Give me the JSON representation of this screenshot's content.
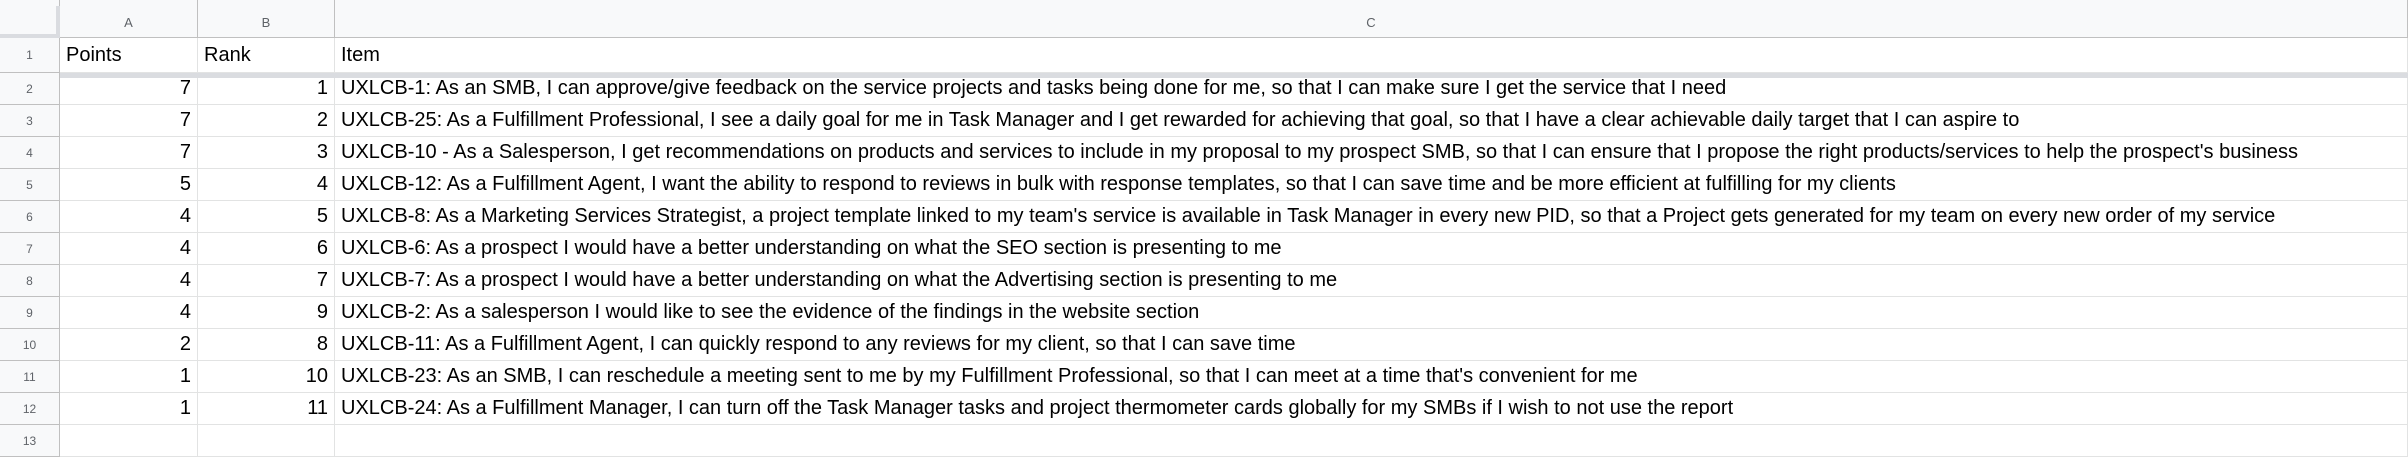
{
  "column_headers": [
    "A",
    "B",
    "C"
  ],
  "row_numbers": [
    "1",
    "2",
    "3",
    "4",
    "5",
    "6",
    "7",
    "8",
    "9",
    "10",
    "11",
    "12",
    "13"
  ],
  "header_row": {
    "points": "Points",
    "rank": "Rank",
    "item": "Item"
  },
  "rows": [
    {
      "points": "7",
      "rank": "1",
      "item": "UXLCB-1: As an SMB, I can approve/give feedback on the service projects and tasks being done for me, so that I can make sure I get the service that I need"
    },
    {
      "points": "7",
      "rank": "2",
      "item": "UXLCB-25: As a Fulfillment Professional, I see a daily goal for me in Task Manager and I get rewarded for achieving that goal, so that I have a clear achievable daily target that I can aspire to"
    },
    {
      "points": "7",
      "rank": "3",
      "item": "UXLCB-10 - As a Salesperson, I get recommendations on products and services to include in my proposal to my prospect SMB, so that I can ensure that I propose the right products/services to help the prospect's business"
    },
    {
      "points": "5",
      "rank": "4",
      "item": "UXLCB-12: As a Fulfillment Agent, I want the ability to respond to reviews in bulk with response templates, so that I can save time and be more efficient at fulfilling for my clients"
    },
    {
      "points": "4",
      "rank": "5",
      "item": "UXLCB-8: As a Marketing Services Strategist, a project template linked to my team's service is available in Task Manager in every new PID, so that a Project gets generated for my team on every new order of my service"
    },
    {
      "points": "4",
      "rank": "6",
      "item": "UXLCB-6: As a prospect I would have a better understanding on what the SEO section is presenting to me"
    },
    {
      "points": "4",
      "rank": "7",
      "item": "UXLCB-7: As a prospect I would have a better understanding on what the Advertising section is presenting to me"
    },
    {
      "points": "4",
      "rank": "9",
      "item": "UXLCB-2: As a salesperson I would like to see the evidence of the findings in the website section"
    },
    {
      "points": "2",
      "rank": "8",
      "item": "UXLCB-11: As a Fulfillment Agent, I can quickly respond to any reviews for my client, so that I can save time"
    },
    {
      "points": "1",
      "rank": "10",
      "item": "UXLCB-23: As an SMB, I can reschedule a meeting sent to me by my Fulfillment Professional, so that I can meet at a time that's convenient for me"
    },
    {
      "points": "1",
      "rank": "11",
      "item": "UXLCB-24: As a Fulfillment Manager, I can turn off the Task Manager tasks and project thermometer cards globally for my SMBs if I wish to not use the report"
    },
    {
      "points": "",
      "rank": "",
      "item": ""
    }
  ]
}
